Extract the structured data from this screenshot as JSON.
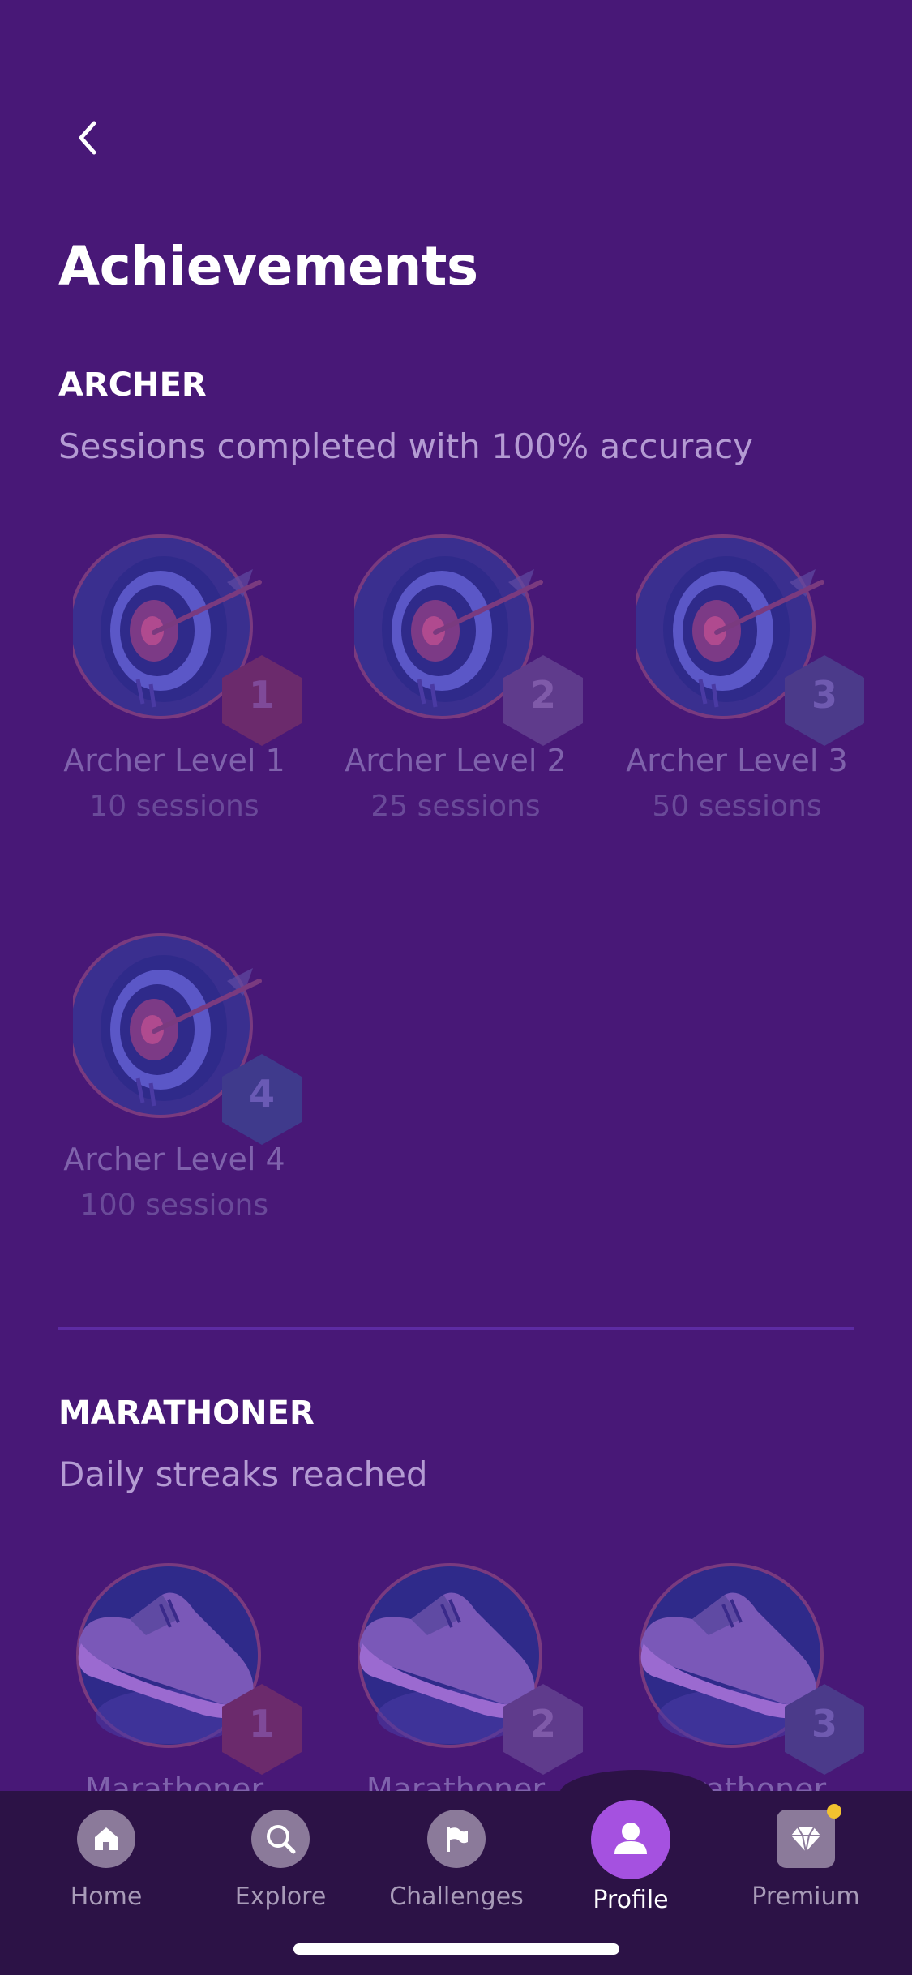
{
  "header": {
    "title": "Achievements"
  },
  "sections": [
    {
      "title": "ARCHER",
      "description": "Sessions completed with 100% accuracy",
      "badges": [
        {
          "level": "1",
          "name": "Archer Level 1",
          "requirement": "10 sessions"
        },
        {
          "level": "2",
          "name": "Archer Level 2",
          "requirement": "25 sessions"
        },
        {
          "level": "3",
          "name": "Archer Level 3",
          "requirement": "50 sessions"
        },
        {
          "level": "4",
          "name": "Archer Level 4",
          "requirement": "100 sessions"
        }
      ]
    },
    {
      "title": "MARATHONER",
      "description": "Daily streaks reached",
      "badges": [
        {
          "level": "1",
          "name": "Marathoner"
        },
        {
          "level": "2",
          "name": "Marathoner"
        },
        {
          "level": "3",
          "name": "Marathoner"
        }
      ]
    }
  ],
  "nav": {
    "items": [
      {
        "label": "Home",
        "icon": "home-icon"
      },
      {
        "label": "Explore",
        "icon": "search-icon"
      },
      {
        "label": "Challenges",
        "icon": "flag-icon"
      },
      {
        "label": "Profile",
        "icon": "person-icon",
        "active": true
      },
      {
        "label": "Premium",
        "icon": "diamond-icon",
        "has_notification": true
      }
    ]
  },
  "colors": {
    "background": "#481877",
    "nav_background": "#2c1246",
    "active_accent": "#a551e0",
    "notification_dot": "#f2c230",
    "level_1_hex": "#6b2a6c",
    "level_2_hex": "#5f3b8c",
    "level_3_hex": "#4b3a8a",
    "level_4_hex": "#3f3a8c"
  }
}
